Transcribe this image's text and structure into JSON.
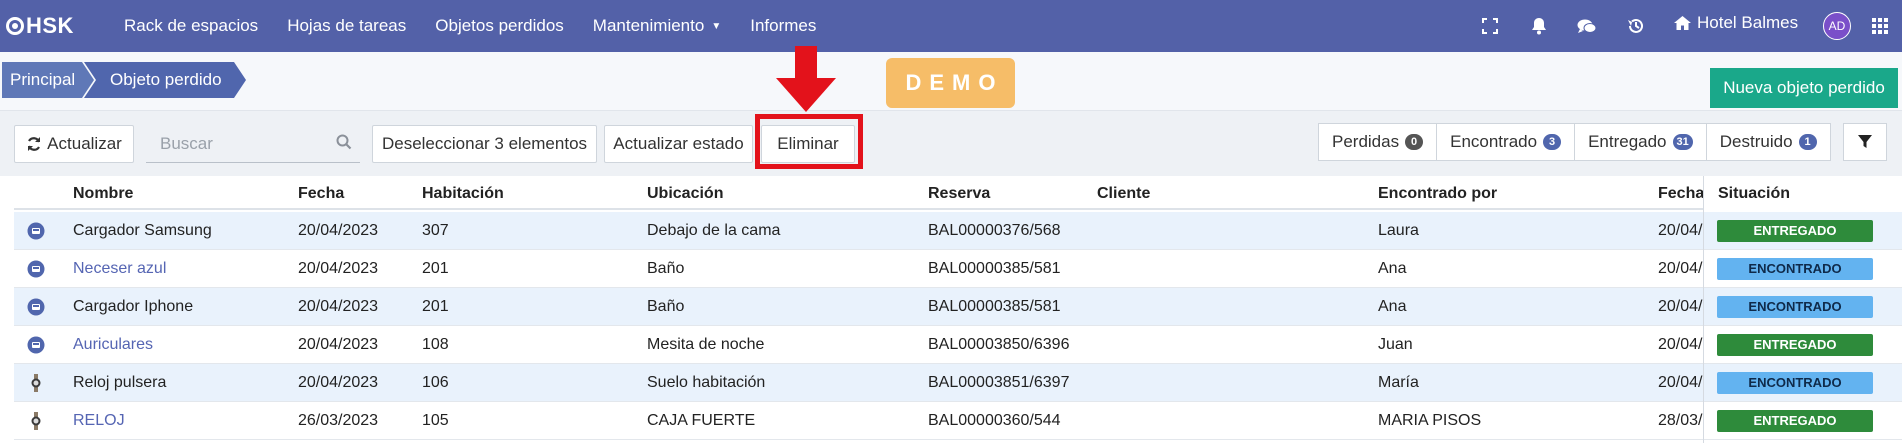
{
  "nav": {
    "logo": "HSK",
    "items": [
      "Rack de espacios",
      "Hojas de tareas",
      "Objetos perdidos",
      "Mantenimiento",
      "Informes"
    ],
    "hotel": "Hotel Balmes",
    "avatar": "AD",
    "icons": [
      "fullscreen-icon",
      "bell-icon",
      "chat-icon",
      "history-icon",
      "home-icon",
      "grid-menu-icon"
    ]
  },
  "breadcrumb": [
    "Principal",
    "Objeto perdido"
  ],
  "demo": "DEMO",
  "new_button": "Nueva objeto perdido",
  "toolbar": {
    "refresh": "Actualizar",
    "search_placeholder": "Buscar",
    "deselect": "Deseleccionar 3 elementos",
    "update_status": "Actualizar estado",
    "delete": "Eliminar"
  },
  "filters": [
    {
      "label": "Perdidas",
      "count": "0",
      "color": "#555555"
    },
    {
      "label": "Encontrado",
      "count": "3",
      "color": "#5066ad"
    },
    {
      "label": "Entregado",
      "count": "31",
      "color": "#5066ad"
    },
    {
      "label": "Destruido",
      "count": "1",
      "color": "#5066ad"
    }
  ],
  "table": {
    "headers": [
      "Nombre",
      "Fecha",
      "Habitación",
      "Ubicación",
      "Reserva",
      "Cliente",
      "Encontrado por",
      "Fecha",
      "Situación"
    ],
    "rows": [
      {
        "nombre": "Cargador Samsung",
        "link": false,
        "fecha": "20/04/2023",
        "hab": "307",
        "ubic": "Debajo de la cama",
        "reserva": "BAL00000376/568",
        "cliente": "",
        "por": "Laura",
        "fecha2": "20/04/",
        "situacion": "ENTREGADO",
        "icon": "object-icon"
      },
      {
        "nombre": "Neceser azul",
        "link": true,
        "fecha": "20/04/2023",
        "hab": "201",
        "ubic": "Baño",
        "reserva": "BAL00000385/581",
        "cliente": "",
        "por": "Ana",
        "fecha2": "20/04/",
        "situacion": "ENCONTRADO",
        "icon": "object-icon"
      },
      {
        "nombre": "Cargador Iphone",
        "link": false,
        "fecha": "20/04/2023",
        "hab": "201",
        "ubic": "Baño",
        "reserva": "BAL00000385/581",
        "cliente": "",
        "por": "Ana",
        "fecha2": "20/04/",
        "situacion": "ENCONTRADO",
        "icon": "object-icon"
      },
      {
        "nombre": "Auriculares",
        "link": true,
        "fecha": "20/04/2023",
        "hab": "108",
        "ubic": "Mesita de noche",
        "reserva": "BAL00003850/6396",
        "cliente": "",
        "por": "Juan",
        "fecha2": "20/04/",
        "situacion": "ENTREGADO",
        "icon": "object-icon"
      },
      {
        "nombre": "Reloj pulsera",
        "link": false,
        "fecha": "20/04/2023",
        "hab": "106",
        "ubic": "Suelo habitación",
        "reserva": "BAL00003851/6397",
        "cliente": "",
        "por": "María",
        "fecha2": "20/04/",
        "situacion": "ENCONTRADO",
        "icon": "watch-photo-icon"
      },
      {
        "nombre": "RELOJ",
        "link": true,
        "fecha": "26/03/2023",
        "hab": "105",
        "ubic": "CAJA FUERTE",
        "reserva": "BAL00000360/544",
        "cliente": "",
        "por": "MARIA PISOS",
        "fecha2": "28/03/",
        "situacion": "ENTREGADO",
        "icon": "watch-photo-icon"
      }
    ]
  },
  "colors": {
    "nav_bg": "#5361a8",
    "new_button": "#1aa88a",
    "demo": "#f6bd68",
    "highlight": "#e3121b",
    "entregado": "#2e8b3b",
    "encontrado": "#63b3f0"
  }
}
